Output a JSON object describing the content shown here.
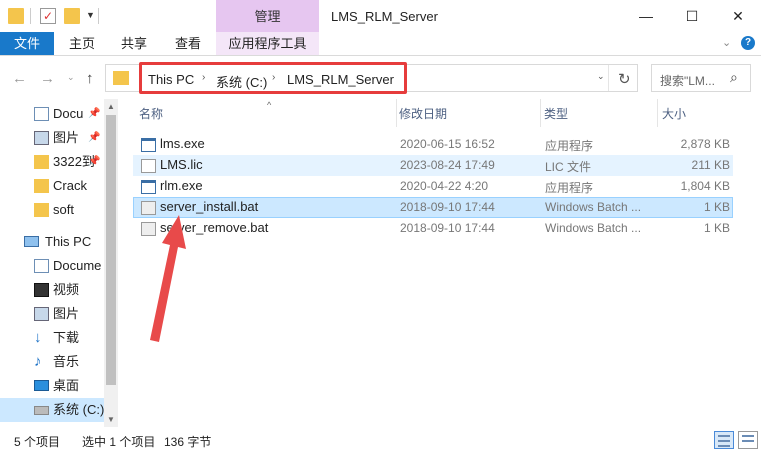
{
  "window": {
    "title": "LMS_RLM_Server",
    "manage_tab": "管理"
  },
  "ribbon": {
    "tabs": [
      "文件",
      "主页",
      "共享",
      "查看",
      "应用程序工具"
    ]
  },
  "address": {
    "crumbs": [
      "This PC",
      "系统 (C:)",
      "LMS_RLM_Server"
    ],
    "search_placeholder": "搜索\"LM..."
  },
  "sidebar": {
    "items": [
      {
        "label": "Docu",
        "icon": "document-icon",
        "pinned": true
      },
      {
        "label": "图片",
        "icon": "picture-icon",
        "pinned": true
      },
      {
        "label": "3322到",
        "icon": "folder-icon",
        "pinned": true
      },
      {
        "label": "Crack",
        "icon": "folder-icon",
        "pinned": false
      },
      {
        "label": "soft",
        "icon": "folder-icon",
        "pinned": false
      },
      {
        "label": "This PC",
        "icon": "pc-icon",
        "pinned": false
      },
      {
        "label": "Docume",
        "icon": "document-icon",
        "pinned": false
      },
      {
        "label": "视频",
        "icon": "video-icon",
        "pinned": false
      },
      {
        "label": "图片",
        "icon": "picture-icon",
        "pinned": false
      },
      {
        "label": "下载",
        "icon": "download-icon",
        "pinned": false
      },
      {
        "label": "音乐",
        "icon": "music-icon",
        "pinned": false
      },
      {
        "label": "桌面",
        "icon": "desktop-icon",
        "pinned": false
      },
      {
        "label": "系统 (C:)",
        "icon": "drive-icon",
        "pinned": false
      }
    ]
  },
  "columns": {
    "name": "名称",
    "date": "修改日期",
    "type": "类型",
    "size": "大小"
  },
  "files": [
    {
      "name": "lms.exe",
      "date": "2020-06-15 16:52",
      "type": "应用程序",
      "size": "2,878 KB",
      "icon": "exe-icon"
    },
    {
      "name": "LMS.lic",
      "date": "2023-08-24 17:49",
      "type": "LIC 文件",
      "size": "211 KB",
      "icon": "lic-icon"
    },
    {
      "name": "rlm.exe",
      "date": "2020-04-22 4:20",
      "type": "应用程序",
      "size": "1,804 KB",
      "icon": "exe-icon"
    },
    {
      "name": "server_install.bat",
      "date": "2018-09-10 17:44",
      "type": "Windows Batch ...",
      "size": "1 KB",
      "icon": "bat-icon"
    },
    {
      "name": "server_remove.bat",
      "date": "2018-09-10 17:44",
      "type": "Windows Batch ...",
      "size": "1 KB",
      "icon": "bat-icon"
    }
  ],
  "status": {
    "count": "5 个项目",
    "selection": "选中 1 个项目",
    "bytes": "136 字节"
  },
  "colors": {
    "accent": "#1979ca",
    "selection": "#cce8ff",
    "annotation": "#e63c3c",
    "manage_tab": "#e6c6f0"
  }
}
